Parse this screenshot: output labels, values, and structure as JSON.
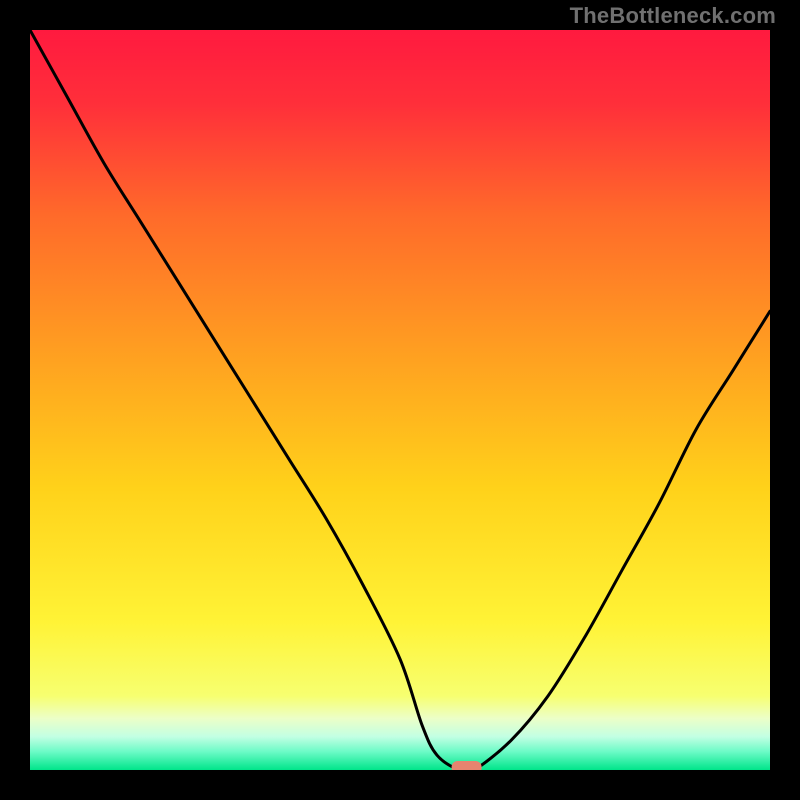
{
  "watermark": "TheBottleneck.com",
  "chart_data": {
    "type": "line",
    "title": "",
    "xlabel": "",
    "ylabel": "",
    "xlim": [
      0,
      100
    ],
    "ylim": [
      0,
      100
    ],
    "x": [
      0,
      5,
      10,
      15,
      20,
      25,
      30,
      35,
      40,
      45,
      50,
      53,
      55,
      58,
      60,
      65,
      70,
      75,
      80,
      85,
      90,
      95,
      100
    ],
    "values": [
      100,
      91,
      82,
      74,
      66,
      58,
      50,
      42,
      34,
      25,
      15,
      6,
      2,
      0,
      0,
      4,
      10,
      18,
      27,
      36,
      46,
      54,
      62
    ],
    "gradient_stops": [
      {
        "pos": 0.0,
        "color": "#ff1a3f"
      },
      {
        "pos": 0.1,
        "color": "#ff2f3a"
      },
      {
        "pos": 0.25,
        "color": "#ff6a2a"
      },
      {
        "pos": 0.45,
        "color": "#ffa320"
      },
      {
        "pos": 0.62,
        "color": "#ffd21a"
      },
      {
        "pos": 0.8,
        "color": "#fff336"
      },
      {
        "pos": 0.9,
        "color": "#f7ff70"
      },
      {
        "pos": 0.93,
        "color": "#ecffc7"
      },
      {
        "pos": 0.955,
        "color": "#c2ffe3"
      },
      {
        "pos": 0.975,
        "color": "#6dfbc7"
      },
      {
        "pos": 1.0,
        "color": "#00e58a"
      }
    ],
    "marker": {
      "x": 59,
      "y": 0,
      "color": "#e6846f"
    }
  }
}
